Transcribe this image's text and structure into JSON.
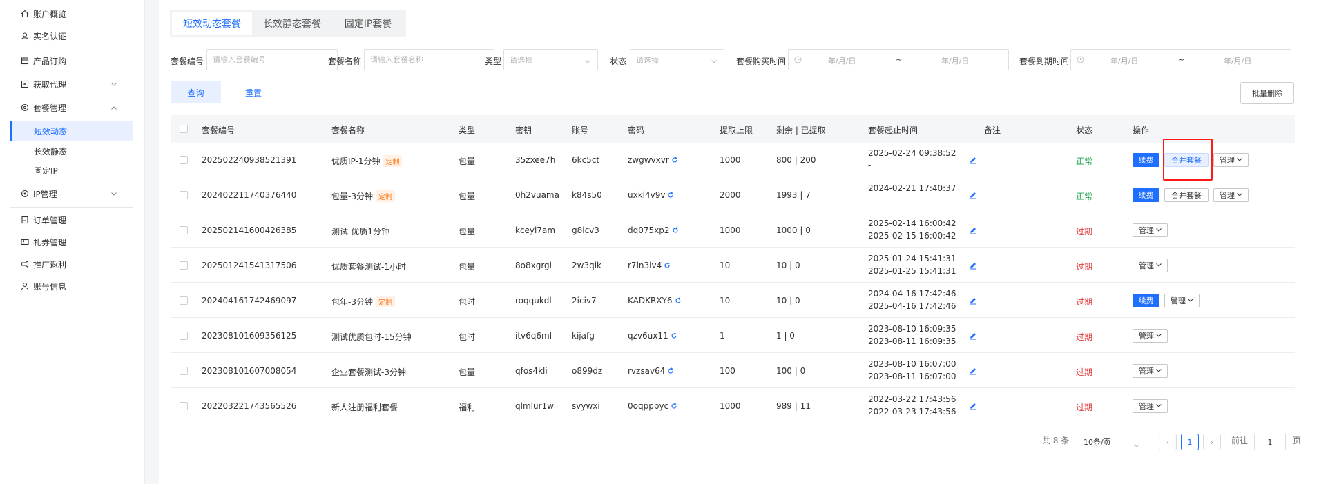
{
  "sidebar": {
    "items": [
      {
        "label": "账户概览",
        "icon": "home-icon"
      },
      {
        "label": "实名认证",
        "icon": "id-card-icon"
      },
      {
        "label": "产品订购",
        "icon": "cart-icon"
      },
      {
        "label": "获取代理",
        "icon": "proxy-icon"
      },
      {
        "label": "套餐管理",
        "icon": "package-icon"
      },
      {
        "label": "IP管理",
        "icon": "location-icon"
      },
      {
        "label": "订单管理",
        "icon": "order-icon"
      },
      {
        "label": "礼券管理",
        "icon": "coupon-icon"
      },
      {
        "label": "推广返利",
        "icon": "promotion-icon"
      },
      {
        "label": "账号信息",
        "icon": "user-icon"
      }
    ],
    "sub_items": [
      "短效动态",
      "长效静态",
      "固定IP"
    ]
  },
  "tabs": [
    "短效动态套餐",
    "长效静态套餐",
    "固定IP套餐"
  ],
  "filters": {
    "package_id_label": "套餐编号",
    "package_id_placeholder": "请输入套餐编号",
    "package_name_label": "套餐名称",
    "package_name_placeholder": "请输入套餐名称",
    "type_label": "类型",
    "type_placeholder": "请选择",
    "status_label": "状态",
    "status_placeholder": "请选择",
    "buy_time_label": "套餐购买时间",
    "expire_time_label": "套餐到期时间",
    "date_placeholder": "年/月/日",
    "range_sep": "~"
  },
  "actions": {
    "query": "查询",
    "reset": "重置",
    "batch_delete": "批量删除"
  },
  "table": {
    "headers": [
      "套餐编号",
      "套餐名称",
      "类型",
      "密钥",
      "账号",
      "密码",
      "提取上限",
      "剩余 | 已提取",
      "套餐起止时间",
      "备注",
      "状态",
      "操作"
    ],
    "rows": [
      {
        "id": "202502240938521391",
        "name": "优质IP-1分钟",
        "tag": "定制",
        "type": "包量",
        "key": "35zxee7h",
        "account": "6kc5ct",
        "password": "zwgwvxvr",
        "limit": "1000",
        "remain": "800 | 200",
        "start": "2025-02-24 09:38:52",
        "end": "-",
        "status": "正常",
        "renew": "续费",
        "merge": "合并套餐",
        "manage": "管理"
      },
      {
        "id": "202402211740376440",
        "name": "包量-3分钟",
        "tag": "定制",
        "type": "包量",
        "key": "0h2vuama",
        "account": "k84s50",
        "password": "uxkl4v9v",
        "limit": "2000",
        "remain": "1993 | 7",
        "start": "2024-02-21 17:40:37",
        "end": "-",
        "status": "正常",
        "renew": "续费",
        "merge": "合并套餐",
        "manage": "管理"
      },
      {
        "id": "202502141600426385",
        "name": "测试-优质1分钟",
        "tag": "",
        "type": "包量",
        "key": "kceyl7am",
        "account": "g8icv3",
        "password": "dq075xp2",
        "limit": "1000",
        "remain": "1000 | 0",
        "start": "2025-02-14 16:00:42",
        "end": "2025-02-15 16:00:42",
        "status": "过期",
        "renew": "",
        "merge": "",
        "manage": "管理"
      },
      {
        "id": "202501241541317506",
        "name": "优质套餐测试-1小时",
        "tag": "",
        "type": "包量",
        "key": "8o8xgrgi",
        "account": "2w3qik",
        "password": "r7ln3iv4",
        "limit": "10",
        "remain": "10 | 0",
        "start": "2025-01-24 15:41:31",
        "end": "2025-01-25 15:41:31",
        "status": "过期",
        "renew": "",
        "merge": "",
        "manage": "管理"
      },
      {
        "id": "202404161742469097",
        "name": "包年-3分钟",
        "tag": "定制",
        "type": "包时",
        "key": "roqqukdl",
        "account": "2iciv7",
        "password": "KADKRXY6",
        "limit": "10",
        "remain": "10 | 0",
        "start": "2024-04-16 17:42:46",
        "end": "2025-04-16 17:42:46",
        "status": "过期",
        "renew": "续费",
        "merge": "",
        "manage": "管理"
      },
      {
        "id": "202308101609356125",
        "name": "测试优质包时-15分钟",
        "tag": "",
        "type": "包时",
        "key": "itv6q6ml",
        "account": "kijafg",
        "password": "qzv6ux11",
        "limit": "1",
        "remain": "1 | 0",
        "start": "2023-08-10 16:09:35",
        "end": "2023-08-11 16:09:35",
        "status": "过期",
        "renew": "",
        "merge": "",
        "manage": "管理"
      },
      {
        "id": "202308101607008054",
        "name": "企业套餐测试-3分钟",
        "tag": "",
        "type": "包量",
        "key": "qfos4kli",
        "account": "o899dz",
        "password": "rvzsav64",
        "limit": "100",
        "remain": "100 | 0",
        "start": "2023-08-10 16:07:00",
        "end": "2023-08-11 16:07:00",
        "status": "过期",
        "renew": "",
        "merge": "",
        "manage": "管理"
      },
      {
        "id": "202203221743565526",
        "name": "新人注册福利套餐",
        "tag": "",
        "type": "福利",
        "key": "qlmlur1w",
        "account": "svywxi",
        "password": "0oqppbyc",
        "limit": "1000",
        "remain": "989 | 11",
        "start": "2022-03-22 17:43:56",
        "end": "2022-03-23 17:43:56",
        "status": "过期",
        "renew": "",
        "merge": "",
        "manage": "管理"
      }
    ]
  },
  "pagination": {
    "total": "共 8 条",
    "page_size": "10条/页",
    "current_page": "1",
    "goto_label": "前往",
    "goto_value": "1",
    "page_unit": "页"
  },
  "colors": {
    "accent": "#1f6fff",
    "ok": "#21a24c",
    "expired": "#e23b3b",
    "tag_text": "#ff7a1a",
    "highlight_frame": "#ff1a1a"
  }
}
